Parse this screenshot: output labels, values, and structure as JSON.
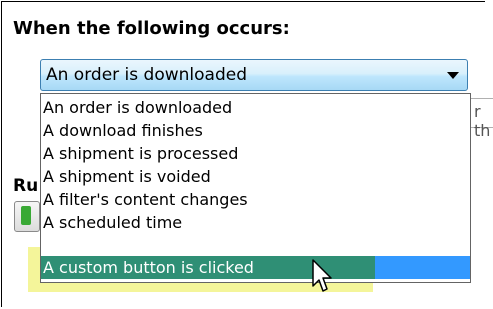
{
  "heading": "When the following occurs:",
  "combo": {
    "value": "An order is downloaded"
  },
  "options": [
    "An order is downloaded",
    "A download finishes",
    "A shipment is processed",
    "A shipment is voided",
    "A filter's content changes",
    "A scheduled time",
    "A custom button is clicked"
  ],
  "selected_index": 6,
  "background": {
    "section_label_partial": "Ru",
    "right_field_partial": "r th"
  },
  "colors": {
    "selection": "#3399ff",
    "highlight_marker": "#f4f59a"
  }
}
